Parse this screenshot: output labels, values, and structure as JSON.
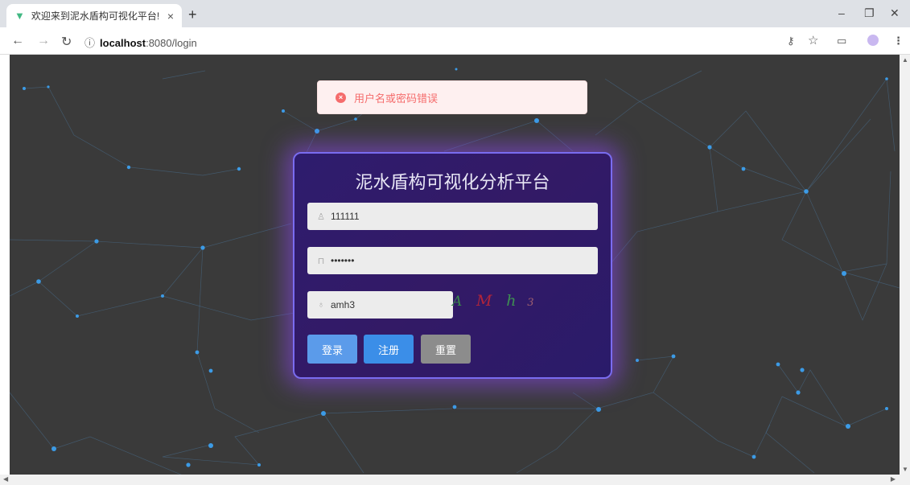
{
  "browser": {
    "tab_title": "欢迎来到泥水盾构可视化平台!",
    "tab_close": "×",
    "new_tab": "+",
    "url_host": "localhost",
    "url_path": ":8080/login",
    "minimize": "–",
    "restore": "❐",
    "close": "✕"
  },
  "message": {
    "text": "用户名或密码错误",
    "icon": "error-circle-icon"
  },
  "login": {
    "title": "泥水盾构可视化分析平台",
    "username_value": "111111",
    "password_value": "•••••••",
    "code_value": "amh3",
    "captcha_chars": [
      "A",
      "M",
      "h",
      "3"
    ],
    "buttons": {
      "login": "登录",
      "register": "注册",
      "reset": "重置"
    }
  },
  "colors": {
    "accent_login": "#5b9bea",
    "accent_register": "#3b8ee8",
    "reset_gray": "#8c8c8c",
    "error": "#f56c6c"
  }
}
